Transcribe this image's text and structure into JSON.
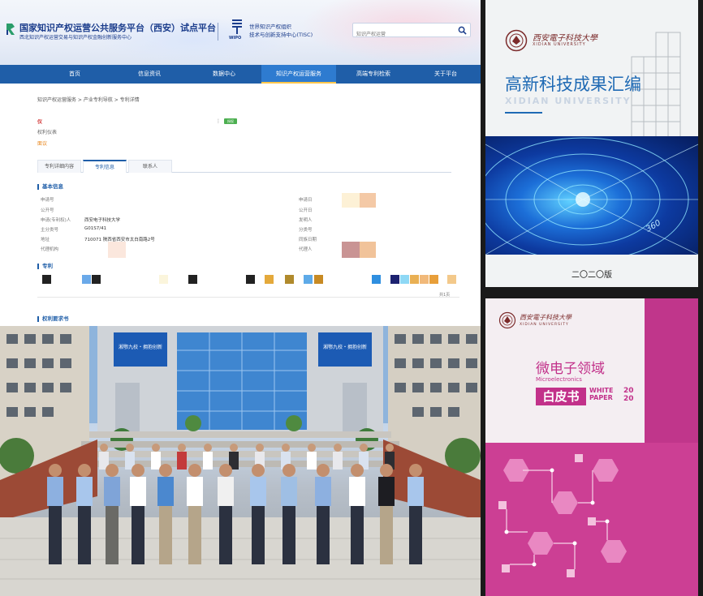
{
  "web": {
    "site_title": "国家知识产权运营公共服务平台（西安）试点平台",
    "site_subtitle": "西北知识产权运营交易与知识产权金融创新服务中心",
    "wipo_logo_text": "WIPO",
    "wipo_name_line1": "世界知识产权组织",
    "wipo_name_line2": "技术与创新支持中心(TISC)",
    "search_placeholder": "知识产权运营",
    "nav": [
      "首页",
      "信息资讯",
      "数据中心",
      "知识产权运营服务",
      "高端专利检索",
      "关于平台"
    ],
    "nav_active_index": 3,
    "breadcrumb": "知识产权运营服务 > 产业专利导航 > 专利详情",
    "patent_title": "仪",
    "patent_status": "权利仪表",
    "patent_price": "面议",
    "tag_label": "授权",
    "tabs": [
      "专利详细内容",
      "专利信息",
      "联系人"
    ],
    "tab_active_index": 1,
    "section_basic": "基本信息",
    "section_claims": "专利",
    "section_bottom": "权利要求书",
    "basic_left": [
      {
        "label": "申请号",
        "value": ""
      },
      {
        "label": "公开号",
        "value": ""
      },
      {
        "label": "申请(专利权)人",
        "value": "西安电子科技大学"
      },
      {
        "label": "主分类号",
        "value": "G01S7/41"
      },
      {
        "label": "地址",
        "value": "710071 陕西省西安市太白南路2号"
      },
      {
        "label": "代理机构",
        "value": ""
      }
    ],
    "basic_right": [
      {
        "label": "申请日"
      },
      {
        "label": "公开日"
      },
      {
        "label": "发明人"
      },
      {
        "label": "分类号"
      },
      {
        "label": "同族日期"
      },
      {
        "label": "代理人"
      }
    ],
    "pager_text": "共1页"
  },
  "book1": {
    "school_cn": "西安電子科技大學",
    "school_en": "XIDIAN UNIVERSITY",
    "title": "高新科技成果汇编",
    "title_en": "XIDIAN UNIVERSITY",
    "art_number": "360",
    "edition": "二〇二〇版"
  },
  "book2": {
    "school_cn": "西安電子科技大學",
    "school_en": "XIDIAN UNIVERSITY",
    "title": "微电子领域",
    "subtitle": "Microelectronics",
    "white_label": "白皮书",
    "wp_line1": "WHITE",
    "wp_line2": "PAPER",
    "year_line1": "20",
    "year_line2": "20"
  },
  "photo": {
    "banner_left": "湘鄂九校・拥抱创新",
    "banner_right": "湘鄂九校・拥抱创新"
  },
  "colors": {
    "nav_blue": "#1f5ea8",
    "book_blue": "#1f6ab4",
    "book_magenta": "#c2318a"
  }
}
